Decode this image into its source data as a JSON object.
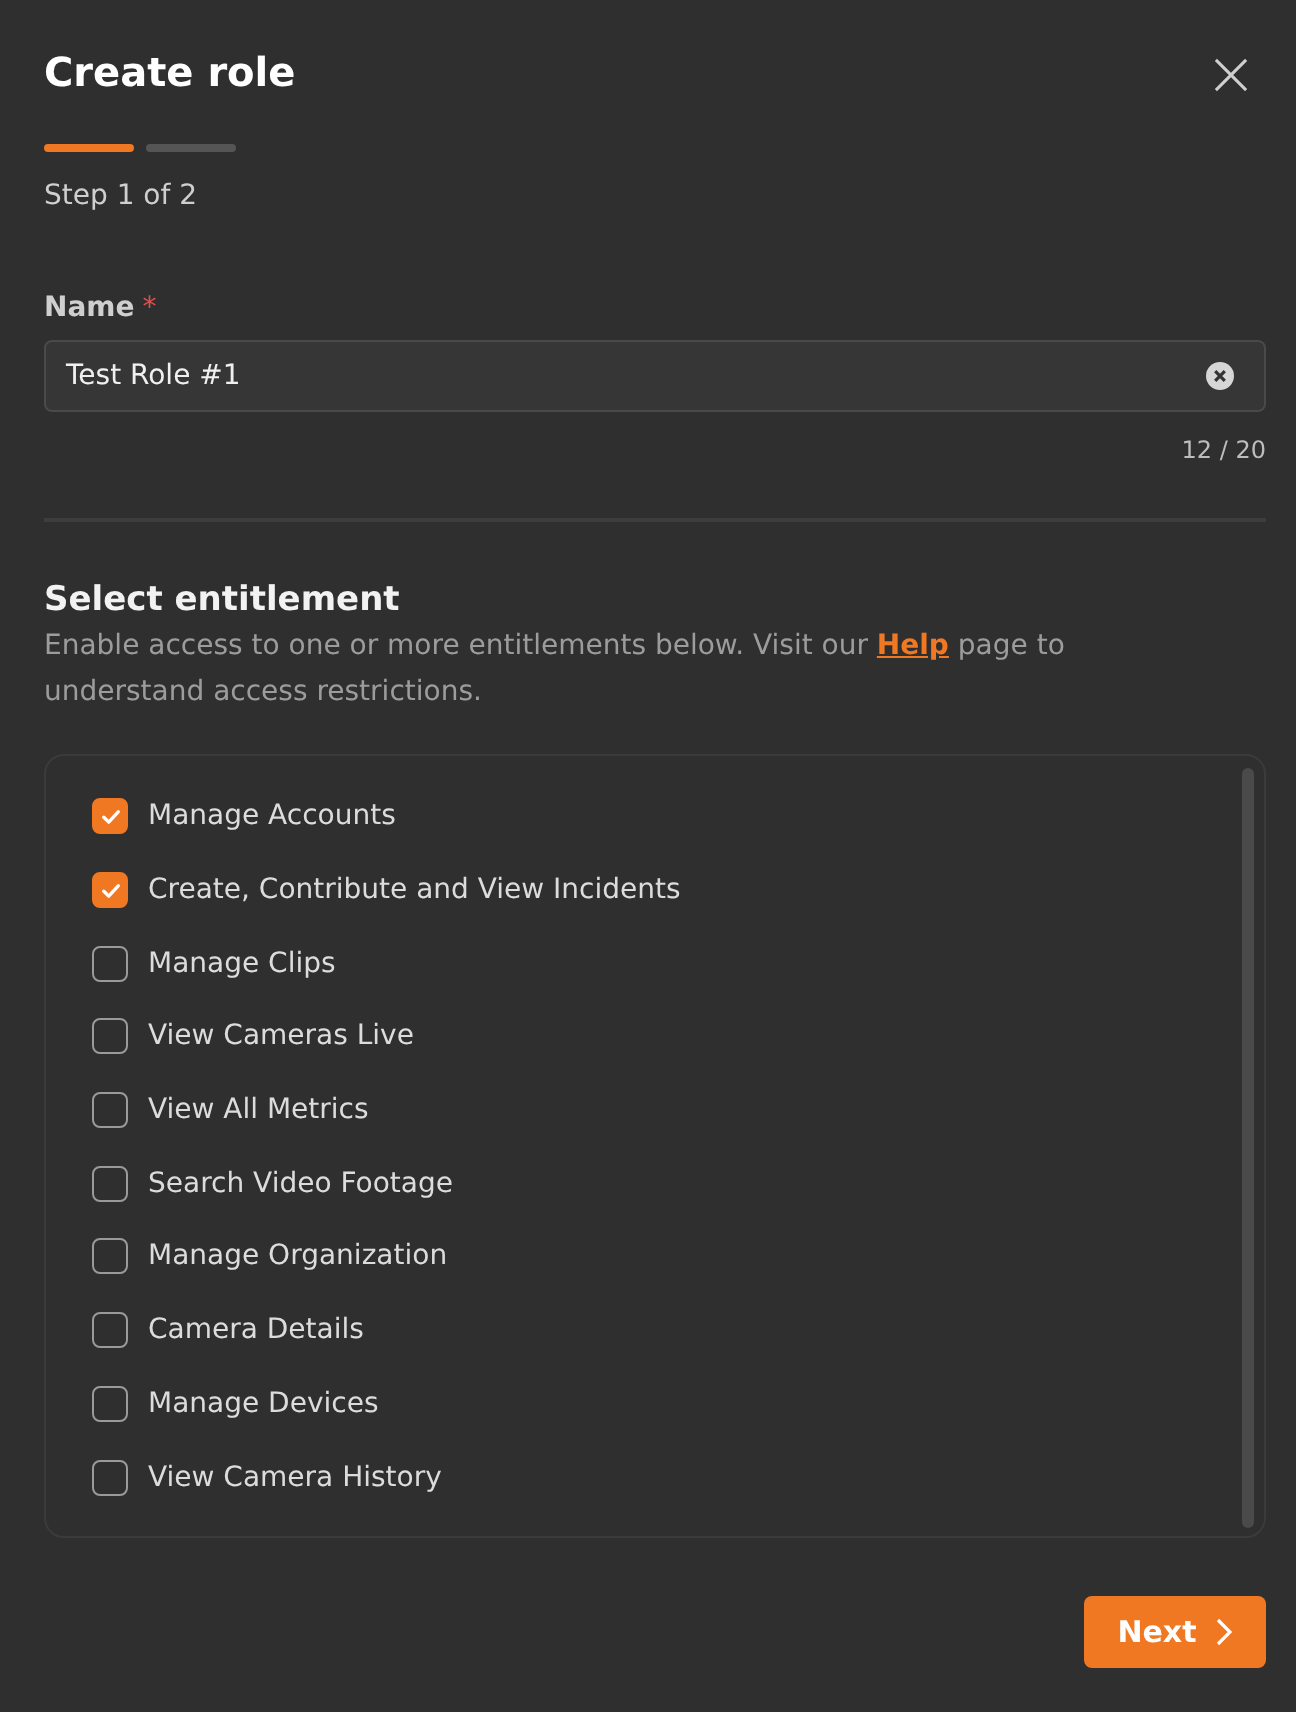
{
  "dialog": {
    "title": "Create role"
  },
  "stepper": {
    "steps": [
      {
        "active": true
      },
      {
        "active": false
      }
    ],
    "caption": "Step 1 of 2"
  },
  "name_field": {
    "label": "Name",
    "required_mark": "*",
    "value": "Test Role #1",
    "counter": "12 / 20"
  },
  "entitlements": {
    "title": "Select entitlement",
    "description_start": "Enable access to one or more entitlements below. Visit our ",
    "help_link": "Help",
    "description_end": " page to understand access restrictions.",
    "items": [
      {
        "label": "Manage Accounts",
        "checked": true
      },
      {
        "label": "Create, Contribute and View Incidents",
        "checked": true
      },
      {
        "label": "Manage Clips",
        "checked": false
      },
      {
        "label": "View Cameras Live",
        "checked": false
      },
      {
        "label": "View All Metrics",
        "checked": false
      },
      {
        "label": "Search Video Footage",
        "checked": false
      },
      {
        "label": "Manage Organization",
        "checked": false
      },
      {
        "label": "Camera Details",
        "checked": false
      },
      {
        "label": "Manage Devices",
        "checked": false
      },
      {
        "label": "View Camera History",
        "checked": false
      }
    ]
  },
  "footer": {
    "next_button": "Next"
  }
}
